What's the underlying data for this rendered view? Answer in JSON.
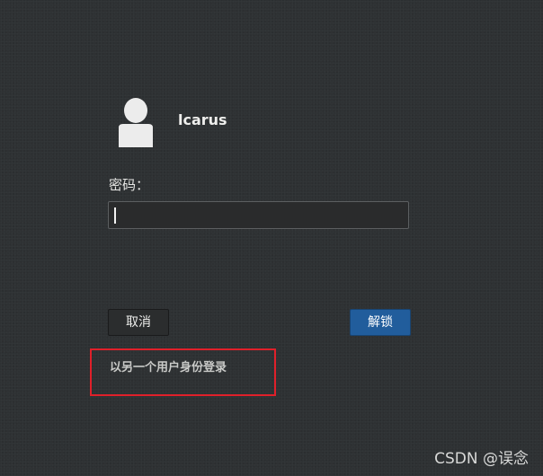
{
  "user": {
    "avatar_icon": "user-avatar-icon",
    "name": "lcarus"
  },
  "password": {
    "label": "密码：",
    "value": "",
    "placeholder": ""
  },
  "buttons": {
    "cancel_label": "取消",
    "unlock_label": "解锁",
    "unlock_color": "#215d9c"
  },
  "switch_user": {
    "label": "以另一个用户身份登录"
  },
  "annotation": {
    "highlight_color": "#e0202a"
  },
  "watermark": {
    "text": "CSDN @误念"
  }
}
